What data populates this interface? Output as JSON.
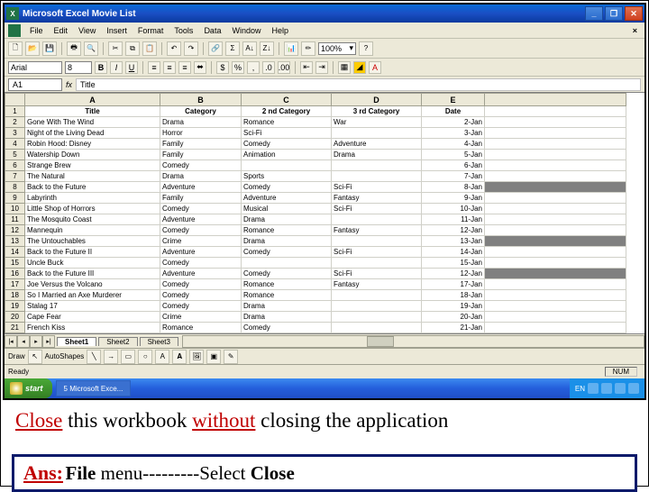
{
  "app": {
    "title": "Microsoft Excel   Movie List"
  },
  "menu": {
    "file": "File",
    "edit": "Edit",
    "view": "View",
    "insert": "Insert",
    "format": "Format",
    "tools": "Tools",
    "data": "Data",
    "window": "Window",
    "help": "Help"
  },
  "toolbar": {
    "zoom": "100%"
  },
  "font": {
    "name": "Arial",
    "size": "8"
  },
  "formula": {
    "namebox": "A1",
    "fx": "fx",
    "value": "Title"
  },
  "columns": {
    "A": "A",
    "B": "B",
    "C": "C",
    "D": "D",
    "E": "E"
  },
  "headers": {
    "title": "Title",
    "category": "Category",
    "cat2": "2 nd Category",
    "cat3": "3 rd Category",
    "date": "Date"
  },
  "rows": [
    {
      "n": "2",
      "a": "Gone With The Wind",
      "b": "Drama",
      "c": "Romance",
      "d": "War",
      "e": "2-Jan"
    },
    {
      "n": "3",
      "a": "Night of the Living Dead",
      "b": "Horror",
      "c": "Sci-Fi",
      "d": "",
      "e": "3-Jan"
    },
    {
      "n": "4",
      "a": "Robin Hood: Disney",
      "b": "Family",
      "c": "Comedy",
      "d": "Adventure",
      "e": "4-Jan"
    },
    {
      "n": "5",
      "a": "Watership Down",
      "b": "Family",
      "c": "Animation",
      "d": "Drama",
      "e": "5-Jan"
    },
    {
      "n": "6",
      "a": "Strange Brew",
      "b": "Comedy",
      "c": "",
      "d": "",
      "e": "6-Jan"
    },
    {
      "n": "7",
      "a": "The Natural",
      "b": "Drama",
      "c": "Sports",
      "d": "",
      "e": "7-Jan"
    },
    {
      "n": "8",
      "a": "Back to the Future",
      "b": "Adventure",
      "c": "Comedy",
      "d": "Sci-Fi",
      "e": "8-Jan"
    },
    {
      "n": "9",
      "a": "Labyrinth",
      "b": "Family",
      "c": "Adventure",
      "d": "Fantasy",
      "e": "9-Jan"
    },
    {
      "n": "10",
      "a": "Little Shop of Horrors",
      "b": "Comedy",
      "c": "Musical",
      "d": "Sci-Fi",
      "e": "10-Jan"
    },
    {
      "n": "11",
      "a": "The Mosquito Coast",
      "b": "Adventure",
      "c": "Drama",
      "d": "",
      "e": "11-Jan"
    },
    {
      "n": "12",
      "a": "Mannequin",
      "b": "Comedy",
      "c": "Romance",
      "d": "Fantasy",
      "e": "12-Jan"
    },
    {
      "n": "13",
      "a": "The Untouchables",
      "b": "Crime",
      "c": "Drama",
      "d": "",
      "e": "13-Jan"
    },
    {
      "n": "14",
      "a": "Back to the Future II",
      "b": "Adventure",
      "c": "Comedy",
      "d": "Sci-Fi",
      "e": "14-Jan"
    },
    {
      "n": "15",
      "a": "Uncle Buck",
      "b": "Comedy",
      "c": "",
      "d": "",
      "e": "15-Jan"
    },
    {
      "n": "16",
      "a": "Back to the Future III",
      "b": "Adventure",
      "c": "Comedy",
      "d": "Sci-Fi",
      "e": "12-Jan"
    },
    {
      "n": "17",
      "a": "Joe Versus the Volcano",
      "b": "Comedy",
      "c": "Romance",
      "d": "Fantasy",
      "e": "17-Jan"
    },
    {
      "n": "18",
      "a": "So I Married an Axe Murderer",
      "b": "Comedy",
      "c": "Romance",
      "d": "",
      "e": "18-Jan"
    },
    {
      "n": "19",
      "a": "Stalag 17",
      "b": "Comedy",
      "c": "Drama",
      "d": "",
      "e": "19-Jan"
    },
    {
      "n": "20",
      "a": "Cape Fear",
      "b": "Crime",
      "c": "Drama",
      "d": "",
      "e": "20-Jan"
    },
    {
      "n": "21",
      "a": "French Kiss",
      "b": "Romance",
      "c": "Comedy",
      "d": "",
      "e": "21-Jan"
    }
  ],
  "sheets": {
    "s1": "Sheet1",
    "s2": "Sheet2",
    "s3": "Sheet3"
  },
  "drawing": {
    "label": "Draw",
    "autoshapes": "AutoShapes"
  },
  "status": {
    "ready": "Ready",
    "num": "NUM"
  },
  "taskbar": {
    "start": "start",
    "task1": "5 Microsoft Exce...",
    "lang": "EN"
  },
  "question": {
    "p1": "Close",
    "p2": " this workbook ",
    "p3": "without",
    "p4": " closing the application"
  },
  "answer": {
    "label": "Ans:",
    "file": "File",
    "mid": " menu---------Select ",
    "close": "Close"
  }
}
